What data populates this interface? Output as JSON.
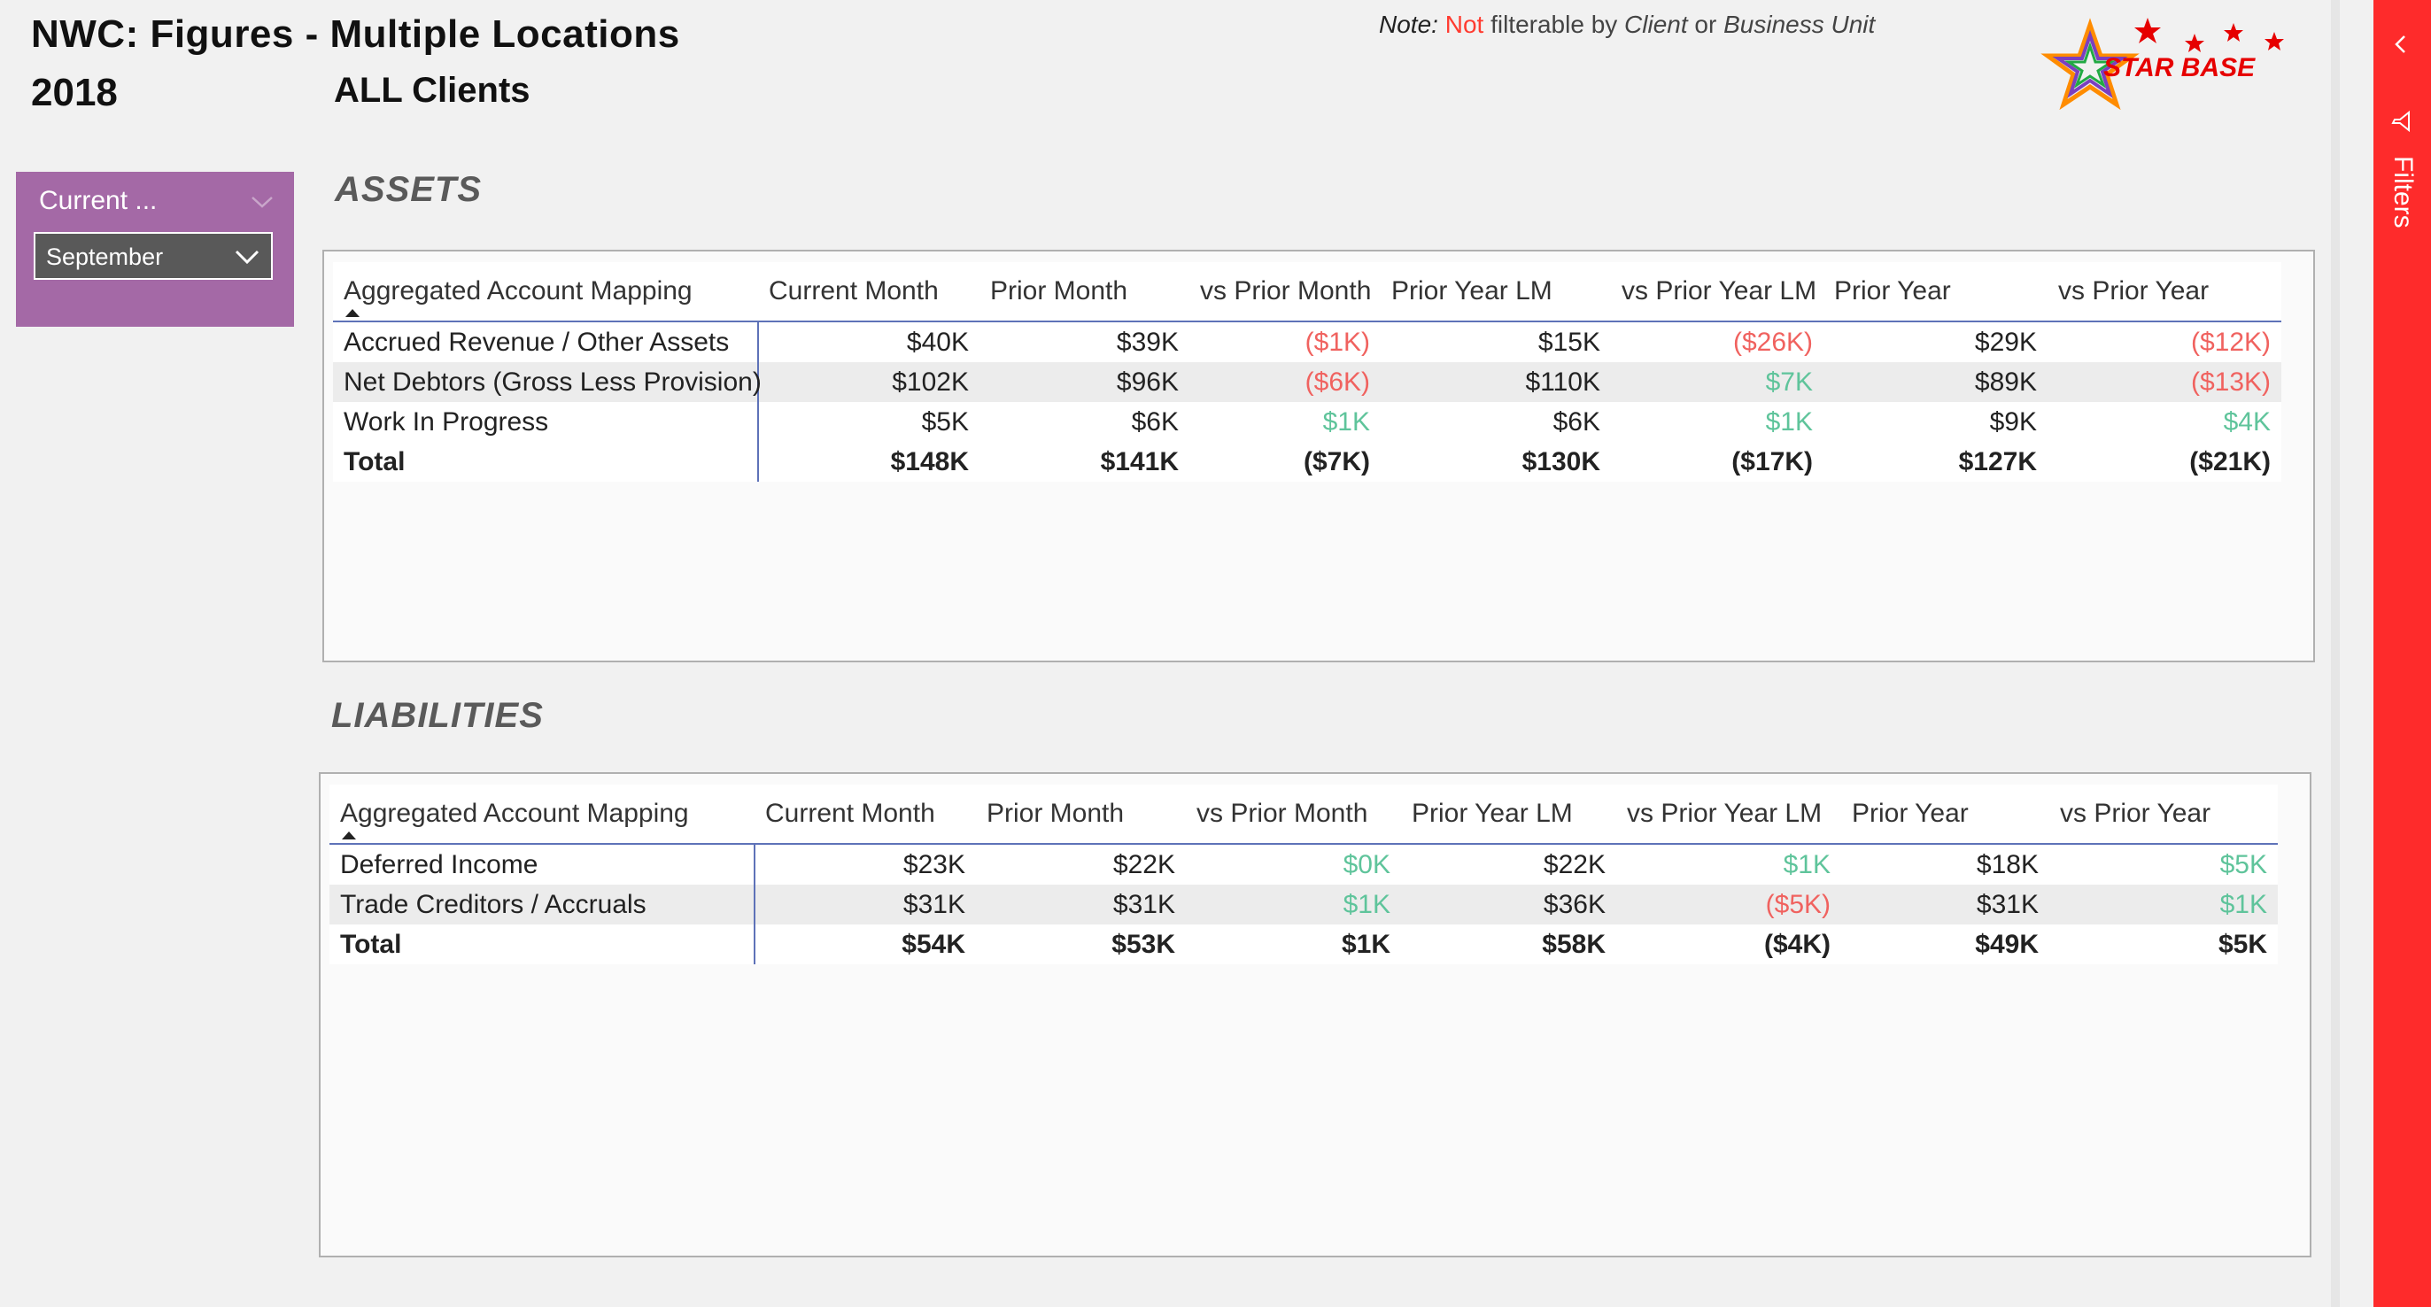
{
  "header": {
    "title": "NWC: Figures - Multiple Locations",
    "year": "2018",
    "clients": "ALL Clients",
    "note_label": "Note:",
    "note_not": "Not",
    "note_mid": " filterable by ",
    "note_client": "Client",
    "note_or": " or ",
    "note_bu": "Business Unit"
  },
  "logo": {
    "text": "STAR BASE"
  },
  "slicer": {
    "header": "Current ...",
    "value": "September"
  },
  "assets": {
    "heading": "ASSETS",
    "columns": [
      "Aggregated Account Mapping",
      "Current Month",
      "Prior Month",
      "vs Prior Month",
      "Prior Year LM",
      "vs Prior Year LM",
      "Prior Year",
      "vs Prior Year"
    ],
    "rows": [
      [
        "Accrued Revenue / Other Assets",
        "$40K",
        "$39K",
        "($1K)",
        "$15K",
        "($26K)",
        "$29K",
        "($12K)"
      ],
      [
        "Net Debtors (Gross Less Provision)",
        "$102K",
        "$96K",
        "($6K)",
        "$110K",
        "$7K",
        "$89K",
        "($13K)"
      ],
      [
        "Work In Progress",
        "$5K",
        "$6K",
        "$1K",
        "$6K",
        "$1K",
        "$9K",
        "$4K"
      ]
    ],
    "total": [
      "Total",
      "$148K",
      "$141K",
      "($7K)",
      "$130K",
      "($17K)",
      "$127K",
      "($21K)"
    ]
  },
  "liabilities": {
    "heading": "LIABILITIES",
    "columns": [
      "Aggregated Account Mapping",
      "Current Month",
      "Prior Month",
      "vs Prior Month",
      "Prior Year LM",
      "vs Prior Year LM",
      "Prior Year",
      "vs Prior Year"
    ],
    "rows": [
      [
        "Deferred Income",
        "$23K",
        "$22K",
        "$0K",
        "$22K",
        "$1K",
        "$18K",
        "$5K"
      ],
      [
        "Trade Creditors / Accruals",
        "$31K",
        "$31K",
        "$1K",
        "$36K",
        "($5K)",
        "$31K",
        "$1K"
      ]
    ],
    "total": [
      "Total",
      "$54K",
      "$53K",
      "$1K",
      "$58K",
      "($4K)",
      "$49K",
      "$5K"
    ]
  },
  "filters_pane": {
    "label": "Filters"
  },
  "colors": {
    "negative": "#f0625f",
    "positive": "#5fc49b",
    "slicer": "#a469a6",
    "filters": "#fe2b2b"
  }
}
